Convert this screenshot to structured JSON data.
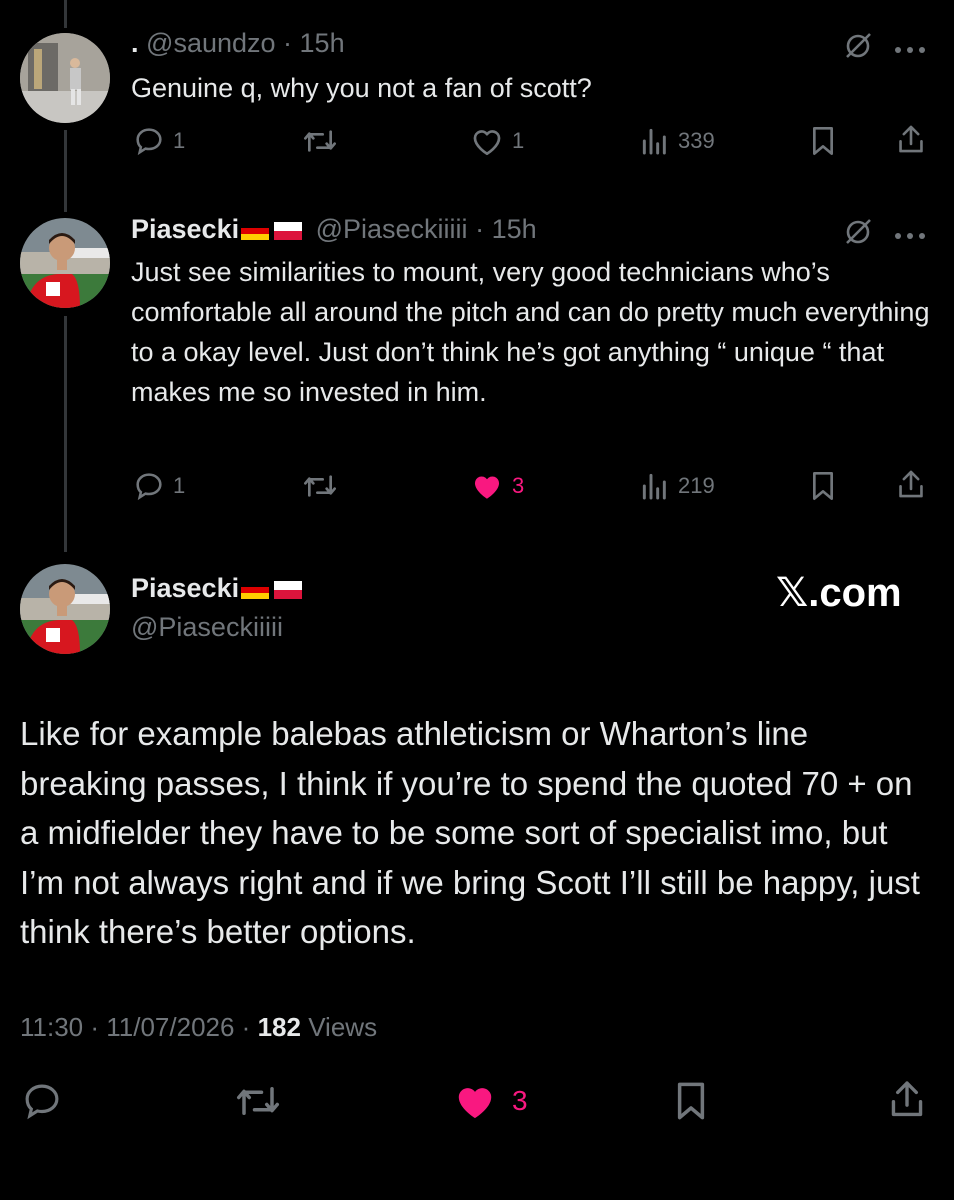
{
  "colors": {
    "background": "#000000",
    "text": "#e7e9ea",
    "muted": "#71767b",
    "like": "#f91880",
    "thread_line": "#333639"
  },
  "reply1": {
    "display_name": ".",
    "handle": "@saundzo",
    "time": "15h",
    "text": "Genuine q, why you not a fan of scott?",
    "replies": "1",
    "likes": "1",
    "views": "339"
  },
  "reply2": {
    "display_name": "Piasecki",
    "handle": "@Piaseckiiiii",
    "time": "15h",
    "text": "Just see similarities to mount, very good technicians who’s comfortable all around the pitch and can do pretty much everything to a okay level. Just don’t think he’s got anything “ unique “ that makes me so invested in him.",
    "replies": "1",
    "likes": "3",
    "views": "219"
  },
  "main": {
    "display_name": "Piasecki",
    "handle": "@Piaseckiiiii",
    "watermark": "𝕏.com",
    "text": "Like for example balebas athleticism or Wharton’s line breaking passes, I think if you’re to spend the quoted 70 + on a midfielder they have to be some sort of specialist imo, but I’m not always right and if we bring Scott I’ll still be happy, just think there’s better options.",
    "time": "11:30",
    "date": "11/07/2026",
    "views_count": "182",
    "views_label": "Views",
    "likes": "3"
  },
  "icons": {
    "reply": "reply-icon",
    "repost": "repost-icon",
    "like": "heart-icon",
    "views": "views-icon",
    "bookmark": "bookmark-icon",
    "share": "share-icon",
    "grok": "grok-icon",
    "more": "more-icon"
  }
}
